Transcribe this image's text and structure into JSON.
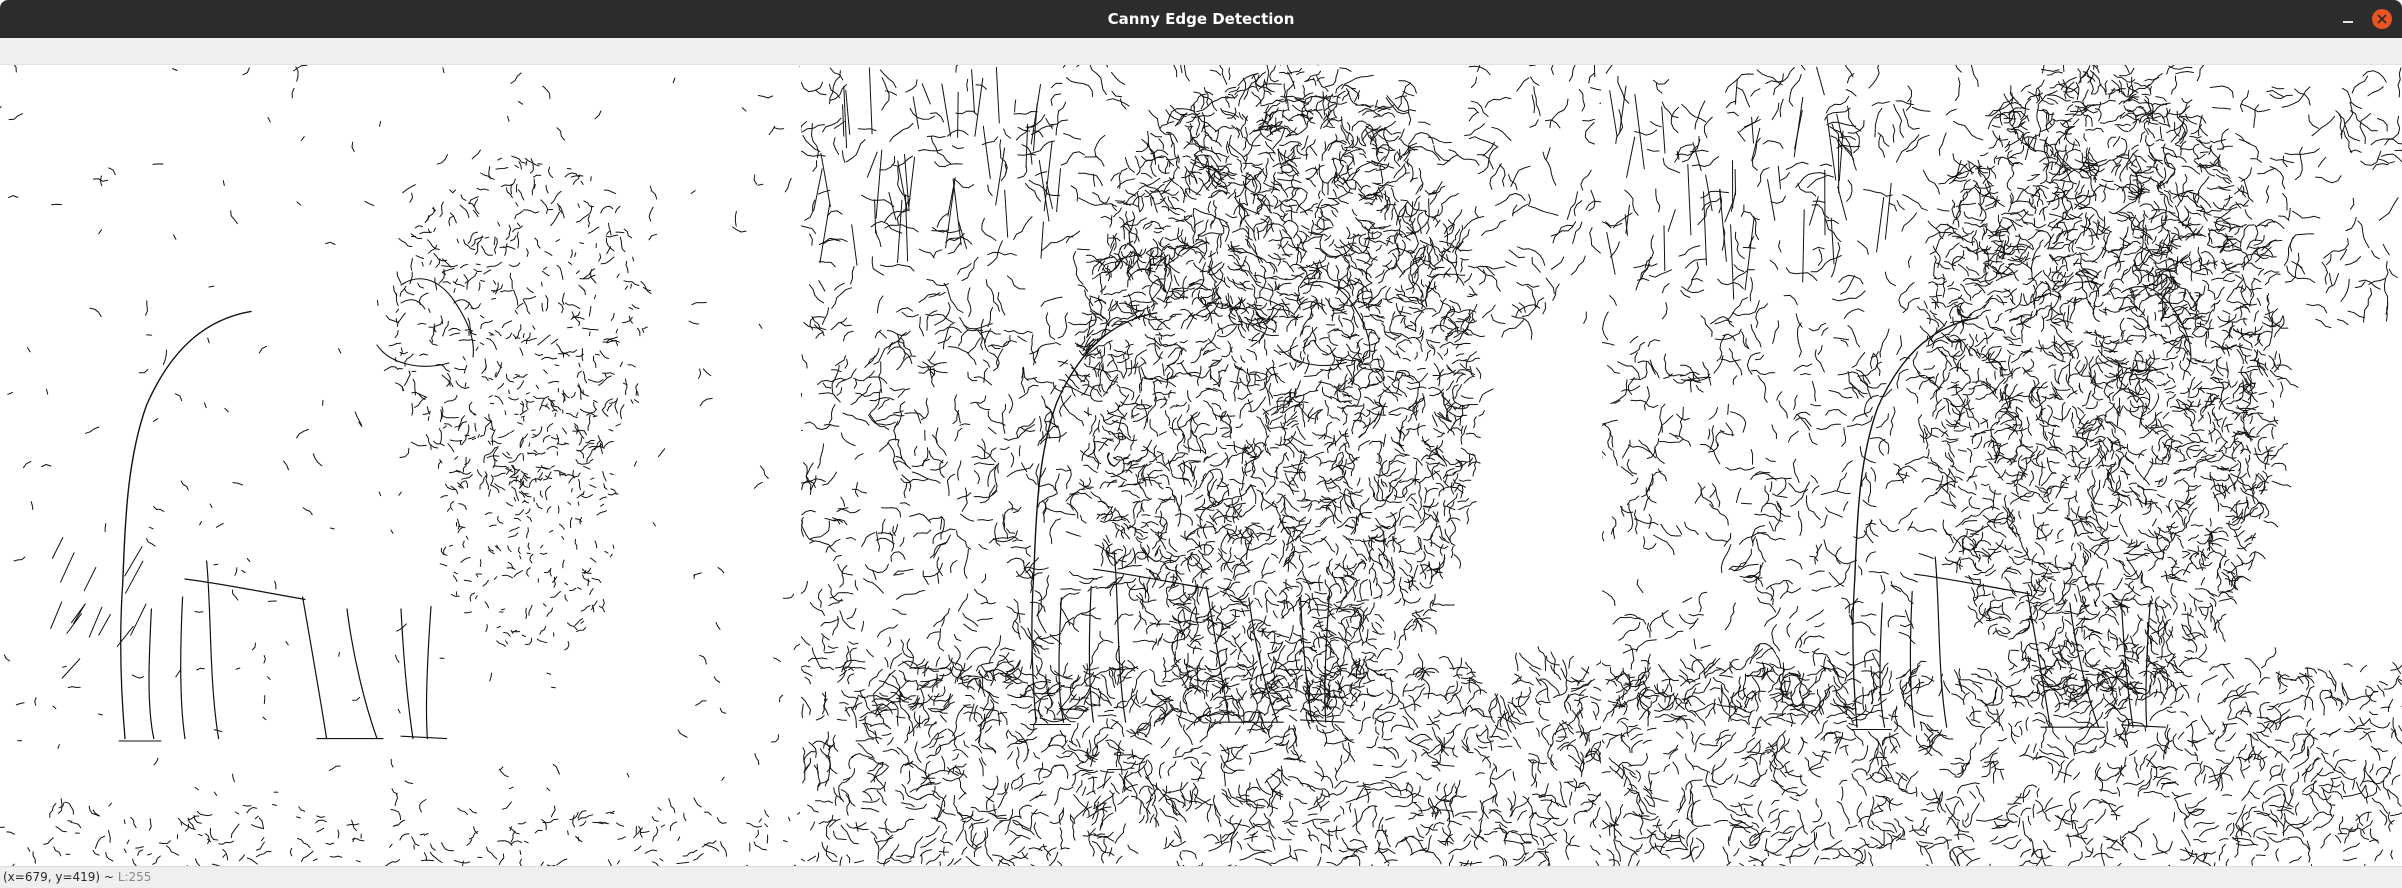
{
  "window": {
    "title": "Canny Edge Detection"
  },
  "panels": [
    {
      "edge_density": "sparse"
    },
    {
      "edge_density": "dense"
    },
    {
      "edge_density": "dense"
    }
  ],
  "status": {
    "coords": "(x=679, y=419) ~",
    "value": "L:255"
  },
  "colors": {
    "titlebar": "#2c2c2c",
    "close_button": "#e95420",
    "toolbar": "#efefef",
    "edge_stroke": "#111111",
    "canvas_background": "#ffffff"
  }
}
